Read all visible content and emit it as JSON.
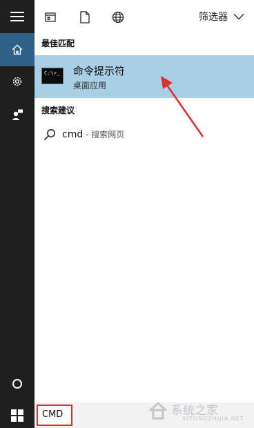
{
  "toolbar": {
    "filter_label": "筛选器",
    "icons": [
      "app-window-icon",
      "document-icon",
      "globe-icon",
      "chevron-down-icon"
    ]
  },
  "rail": {
    "icons": [
      "hamburger-icon",
      "home-icon",
      "settings-gear-icon",
      "user-feedback-icon",
      "cortana-circle-icon"
    ],
    "active": "home"
  },
  "best_match": {
    "title": "最佳匹配",
    "item_name": "命令提示符",
    "item_subtitle": "桌面应用",
    "icon_glyph": "C:\\>_"
  },
  "search_suggestions": {
    "title": "搜索建议",
    "items": [
      {
        "query": "cmd",
        "suffix": " - 搜索网页"
      }
    ]
  },
  "taskbar": {
    "search_value": "CMD"
  },
  "colors": {
    "rail_bg": "#1f1f1f",
    "active_rail": "#2d5f87",
    "highlight": "#a8cfe6",
    "annotation_red": "#e0302d"
  },
  "watermark": {
    "text": "系统之家",
    "url": "XITONGZHIJIA.NET"
  }
}
